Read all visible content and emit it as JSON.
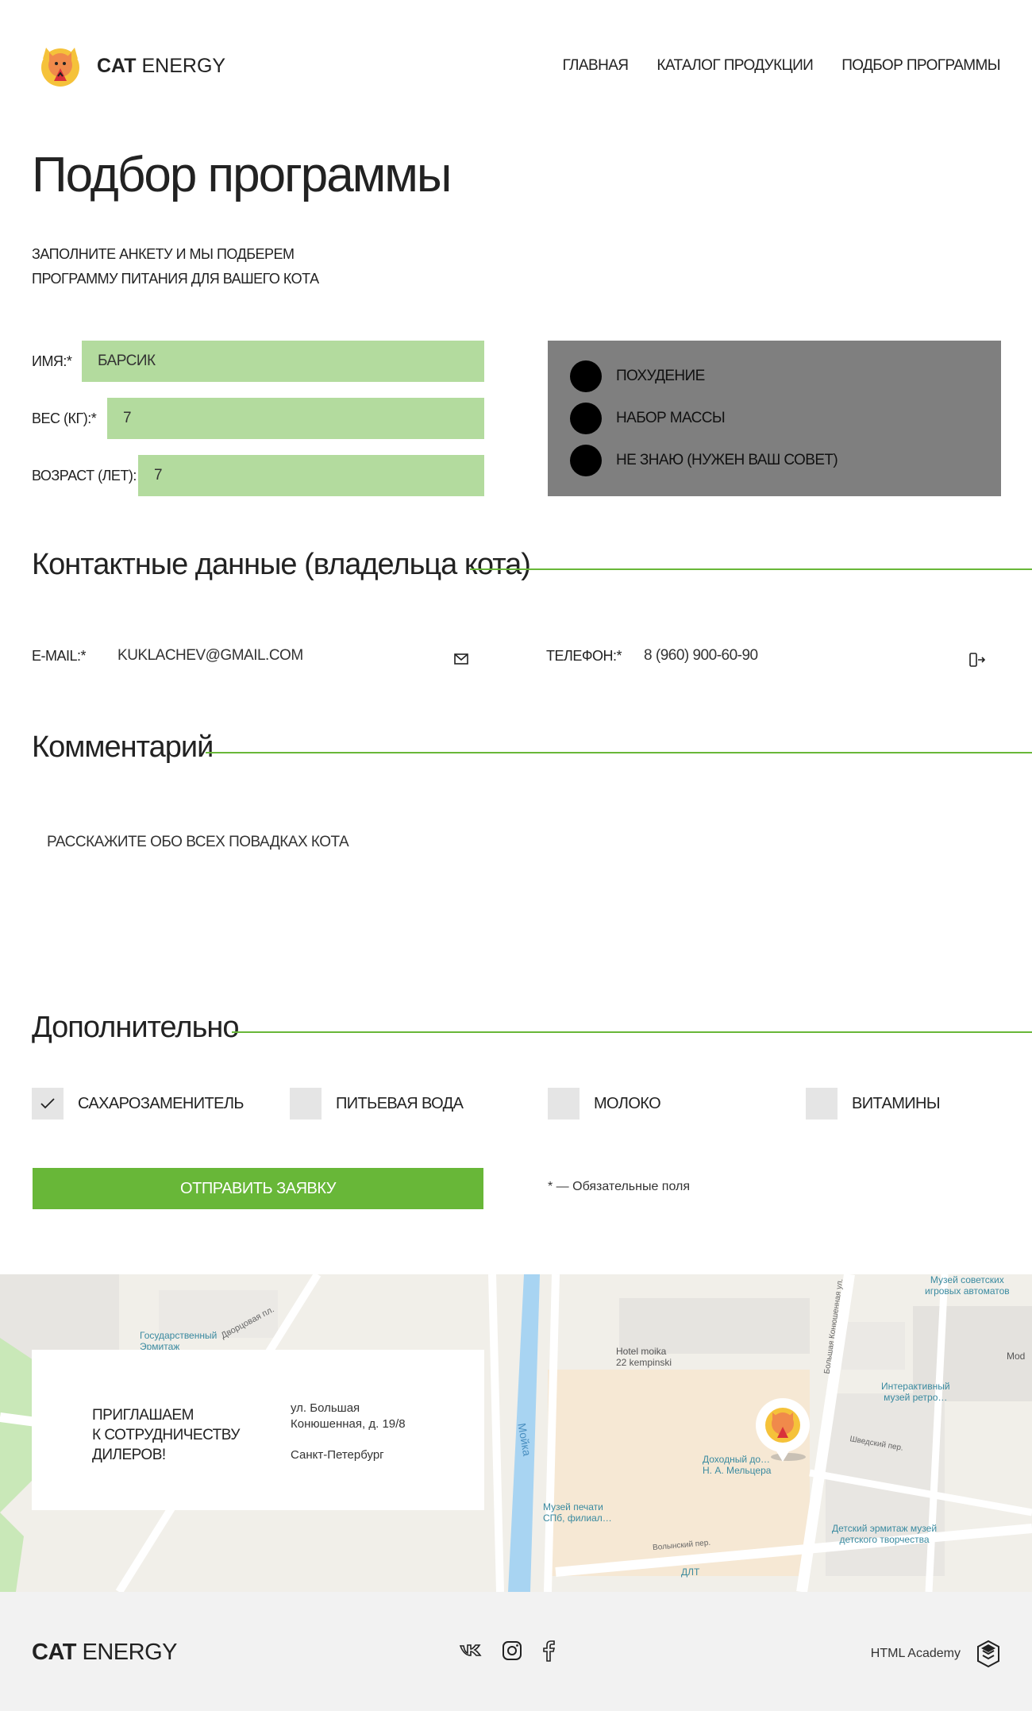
{
  "brand": {
    "name_bold": "CAT",
    "name_light": "ENERGY"
  },
  "nav": {
    "items": [
      {
        "label": "ГЛАВНАЯ"
      },
      {
        "label": "КАТАЛОГ ПРОДУКЦИИ"
      },
      {
        "label": "ПОДБОР ПРОГРАММЫ"
      }
    ]
  },
  "page": {
    "title": "Подбор программы",
    "intro": "ЗАПОЛНИТЕ АНКЕТУ И МЫ ПОДБЕРЕМ\nПРОГРАММУ ПИТАНИЯ ДЛЯ ВАШЕГО КОТА"
  },
  "form": {
    "name": {
      "label": "ИМЯ:*",
      "value": "БАРСИК"
    },
    "weight": {
      "label": "ВЕС (КГ):*",
      "value": "7"
    },
    "age": {
      "label": "ВОЗРАСТ (ЛЕТ):",
      "value": "7"
    },
    "goals": [
      {
        "label": "ПОХУДЕНИЕ"
      },
      {
        "label": "НАБОР МАССЫ"
      },
      {
        "label": "НЕ ЗНАЮ (НУЖЕН ВАШ СОВЕТ)"
      }
    ]
  },
  "contacts": {
    "title": "Контактные данные (владельца кота)",
    "email": {
      "label": "E-MAIL:*",
      "value": "KUKLACHEV@GMAIL.COM",
      "icon": "mail-icon"
    },
    "phone": {
      "label": "ТЕЛЕФОН:*",
      "value": "8 (960) 900-60-90",
      "icon": "phone-icon"
    }
  },
  "comment": {
    "title": "Комментарий",
    "placeholder": "РАССКАЖИТЕ ОБО ВСЕХ ПОВАДКАХ КОТА"
  },
  "extras": {
    "title": "Дополнительно",
    "options": [
      {
        "label": "САХАРОЗАМЕНИТЕЛЬ",
        "checked": true
      },
      {
        "label": "ПИТЬЕВАЯ ВОДА",
        "checked": false
      },
      {
        "label": "МОЛОКО",
        "checked": false
      },
      {
        "label": "ВИТАМИНЫ",
        "checked": false
      }
    ]
  },
  "submit": {
    "label": "ОТПРАВИТЬ ЗАЯВКУ"
  },
  "required_note": "* — Обязательные поля",
  "map": {
    "card_title": "ПРИГЛАШАЕМ\nК СОТРУДНИЧЕСТВУ\nДИЛЕРОВ!",
    "address": "ул. Большая\nКонюшенная, д. 19/8",
    "city": "Санкт-Петербург",
    "labels": {
      "hermitage": "Государственный\nЭрмитаж",
      "square1": "Дворцовая пл.",
      "square2": "Дворцовая пл.",
      "moika": "Мойка",
      "hotel": "Hotel moika\n22 kempinski",
      "museum_games": "Музей советских\nигровых автоматов",
      "museum_retro": "Интерактивный\nмузей ретро…",
      "house": "Доходный до…\nН. А. Мельцера",
      "print": "Музей печати\nСПб, филиал…",
      "kids": "Детский эрмитаж музей\nдетского творчества",
      "dlt": "ДЛТ",
      "volynsky": "Волынский пер.",
      "shvedsky": "Шведский пер.",
      "bkon": "Большая Конюшенная ул.",
      "mod": "Mod"
    }
  },
  "footer": {
    "brand_bold": "CAT",
    "brand_light": "ENERGY",
    "academy": "HTML Academy",
    "socials": [
      "vk-icon",
      "instagram-icon",
      "facebook-icon"
    ]
  },
  "colors": {
    "accent": "#68b738",
    "field": "#b3db9e",
    "radio_bg": "#7f7f7f",
    "footer_bg": "#f2f2f2"
  }
}
